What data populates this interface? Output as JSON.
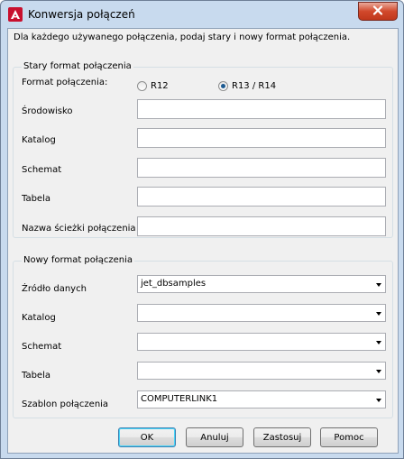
{
  "window": {
    "title": "Konwersja połączeń"
  },
  "description": "Dla każdego używanego połączenia, podaj stary i nowy format połączenia.",
  "old_format": {
    "group_title": "Stary format połączenia",
    "format_label": "Format połączenia:",
    "radio_r12": "R12",
    "radio_r13": "R13 / R14",
    "selected": "R13 / R14",
    "environment_label": "Środowisko",
    "environment_value": "",
    "catalog_label": "Katalog",
    "catalog_value": "",
    "schema_label": "Schemat",
    "schema_value": "",
    "table_label": "Tabela",
    "table_value": "",
    "path_label": "Nazwa ścieżki połączenia",
    "path_value": ""
  },
  "new_format": {
    "group_title": "Nowy format połączenia",
    "source_label": "Źródło danych",
    "source_value": "jet_dbsamples",
    "catalog_label": "Katalog",
    "catalog_value": "",
    "schema_label": "Schemat",
    "schema_value": "",
    "table_label": "Tabela",
    "table_value": "",
    "template_label": "Szablon połączenia",
    "template_value": "COMPUTERLINK1"
  },
  "buttons": {
    "ok": "OK",
    "cancel": "Anuluj",
    "apply": "Zastosuj",
    "help": "Pomoc"
  },
  "colors": {
    "title_bar": "#c8daee",
    "close_button": "#d2492c",
    "dialog_bg": "#f0f0f0",
    "app_icon": "#c8102e"
  }
}
